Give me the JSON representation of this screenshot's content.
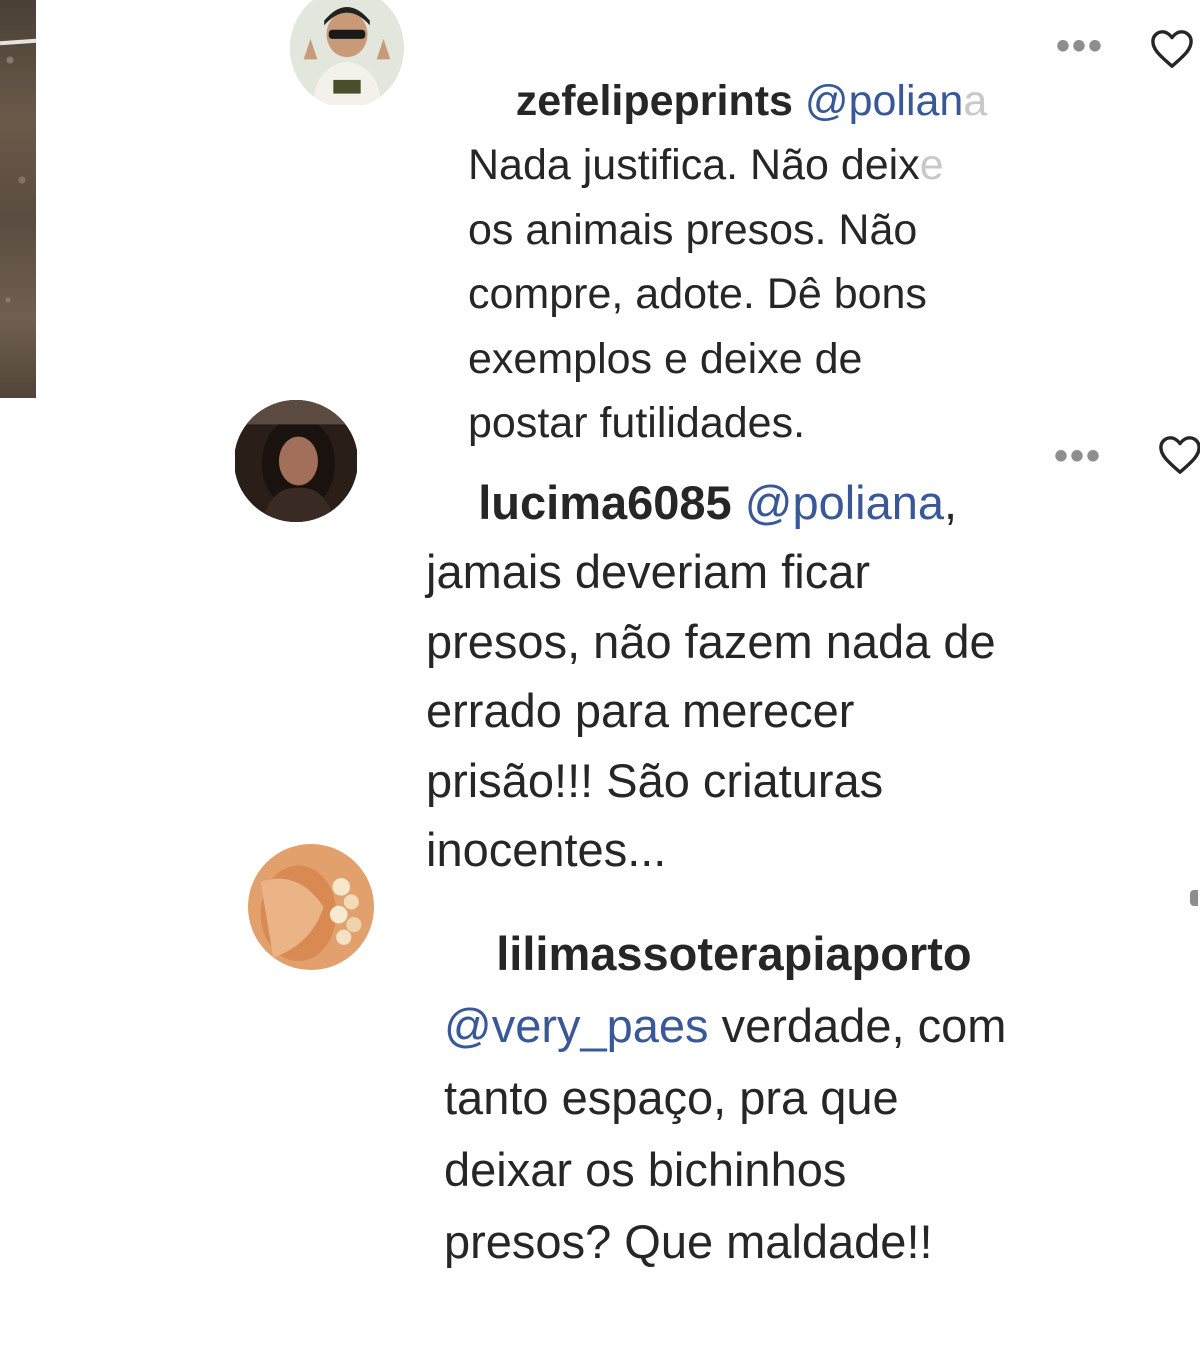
{
  "comments": [
    {
      "username": "zefelipeprints",
      "mention": "@polian",
      "mention_fade": "a",
      "line1_main": "Nada justifica. Não deix",
      "line1_fade": "e",
      "lines": [
        "os animais presos. Não",
        "compre, adote. Dê bons",
        "exemplos e deixe de",
        "postar futilidades."
      ]
    },
    {
      "username": "lucima6085",
      "mention": "@poliana",
      "after_mention": ",",
      "lines": [
        "jamais deveriam ficar",
        "presos, não fazem nada de",
        "errado para merecer",
        "prisão!!! São criaturas",
        "inocentes..."
      ]
    },
    {
      "username": "lilimassoterapiaporto",
      "mention": "@very_paes",
      "after_mention": " verdade, com",
      "lines": [
        "tanto espaço, pra que",
        "deixar os bichinhos",
        "presos? Que maldade!!"
      ]
    }
  ],
  "icons": {
    "more": "more-options-icon",
    "like": "heart-icon"
  },
  "colors": {
    "text": "#262626",
    "mention": "#385898",
    "icon": "#8e8e8e"
  }
}
